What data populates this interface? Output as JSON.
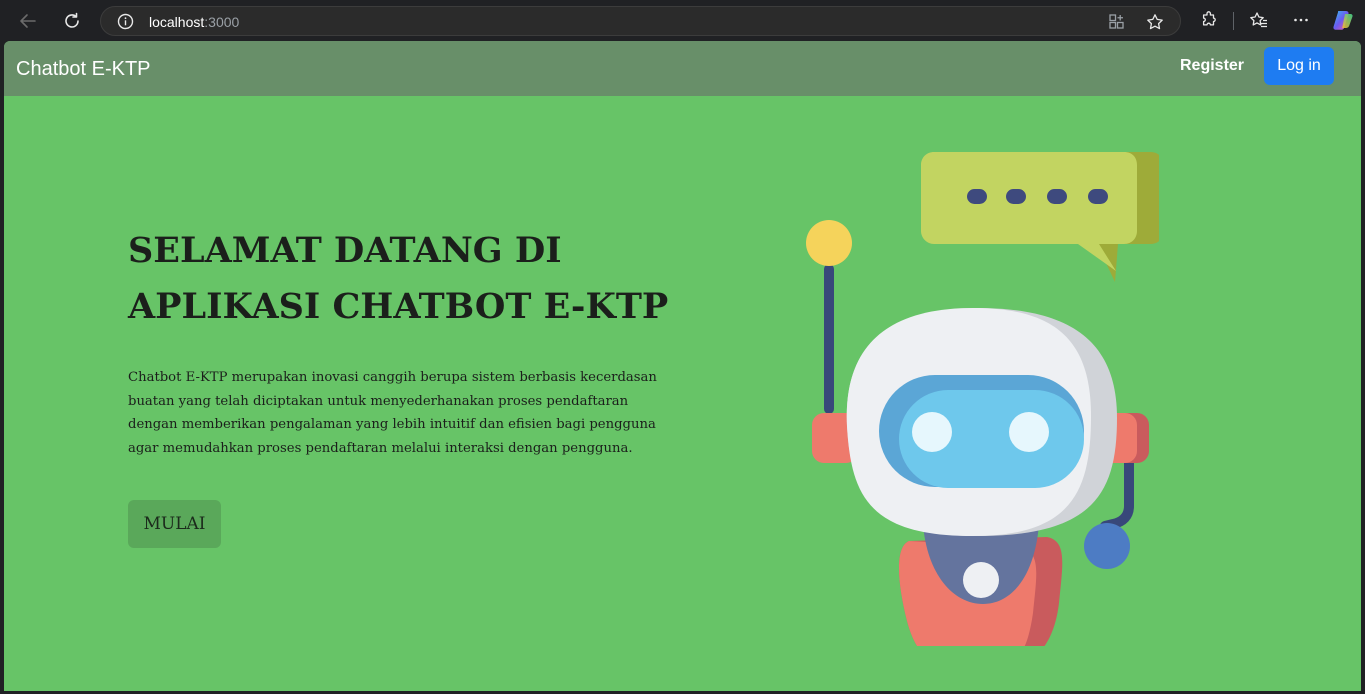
{
  "browser": {
    "url_host": "localhost",
    "url_port": ":3000",
    "icons": [
      "back-arrow-icon",
      "refresh-icon",
      "info-icon",
      "app-grid-icon",
      "star-icon",
      "extensions-icon",
      "favorites-icon",
      "more-icon",
      "copilot-icon"
    ]
  },
  "navbar": {
    "brand": "Chatbot E-KTP",
    "register_label": "Register",
    "login_label": "Log in"
  },
  "hero": {
    "title_line1": "SELAMAT DATANG DI",
    "title_line2": "APLIKASI CHATBOT E-KTP",
    "description": "Chatbot E-KTP merupakan inovasi canggih berupa sistem berbasis kecerdasan buatan yang telah diciptakan untuk menyederhanakan proses pendaftaran dengan memberikan pengalaman yang lebih intuitif dan efisien bagi pengguna agar memudahkan proses pendaftaran melalui interaksi dengan pengguna.",
    "start_label": "MULAI"
  },
  "colors": {
    "page_bg": "#67c467",
    "navbar_bg": "#688f69",
    "login_bg": "#1e7cf2",
    "start_bg": "#5aa85a"
  }
}
